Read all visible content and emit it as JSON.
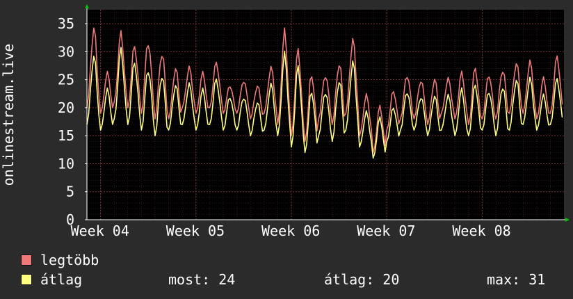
{
  "chart_data": {
    "type": "line",
    "ylabel": "onlinestream.live",
    "ylim": [
      0,
      37.5
    ],
    "yticks": [
      0,
      5,
      10,
      15,
      20,
      25,
      30,
      35
    ],
    "x_range_days": [
      0,
      35
    ],
    "x_ticks": [
      {
        "label": "Week 04",
        "day": 1
      },
      {
        "label": "Week 05",
        "day": 8
      },
      {
        "label": "Week 06",
        "day": 15
      },
      {
        "label": "Week 07",
        "day": 22
      },
      {
        "label": "Week 08",
        "day": 29
      }
    ],
    "grid": true,
    "colors": {
      "background": "#000000",
      "grid": "#4a2424",
      "axis": "#ffffff",
      "arrow": "#00c000"
    },
    "series": [
      {
        "name": "legtöbb",
        "color": "#f07878",
        "daily_min": [
          20,
          19,
          21,
          20,
          19,
          18,
          18,
          20,
          19,
          20,
          19,
          19,
          18,
          19,
          17,
          15,
          14,
          18,
          17,
          19,
          15,
          12,
          16,
          18,
          18,
          17,
          19,
          18,
          17,
          18,
          18,
          19,
          19,
          18,
          19
        ],
        "daily_max": [
          34,
          26,
          33,
          31,
          32,
          30,
          27,
          27,
          26,
          28,
          24,
          25,
          24,
          27,
          33,
          30,
          26,
          26,
          28,
          32,
          22,
          20,
          23,
          26,
          25,
          25,
          25,
          26,
          27,
          26,
          27,
          28,
          28,
          25,
          29
        ]
      },
      {
        "name": "átlag",
        "color": "#ffff80",
        "daily_min": [
          17,
          16,
          18,
          17,
          16,
          15,
          16,
          17,
          16,
          17,
          16,
          16,
          15,
          16,
          15,
          13,
          12,
          15,
          14,
          16,
          13,
          11,
          14,
          16,
          16,
          15,
          16,
          15,
          15,
          16,
          15,
          16,
          17,
          16,
          17
        ],
        "daily_max": [
          29,
          23,
          30,
          28,
          27,
          26,
          24,
          24,
          23,
          25,
          22,
          22,
          21,
          24,
          29,
          27,
          23,
          23,
          25,
          28,
          19,
          18,
          20,
          23,
          22,
          22,
          22,
          23,
          24,
          23,
          24,
          25,
          25,
          22,
          25
        ]
      }
    ]
  },
  "legend": {
    "max_label": "legtöbb",
    "avg_label": "átlag",
    "now_text": "most: 24",
    "avg_text": "átlag: 20",
    "max_text": "max: 31"
  }
}
